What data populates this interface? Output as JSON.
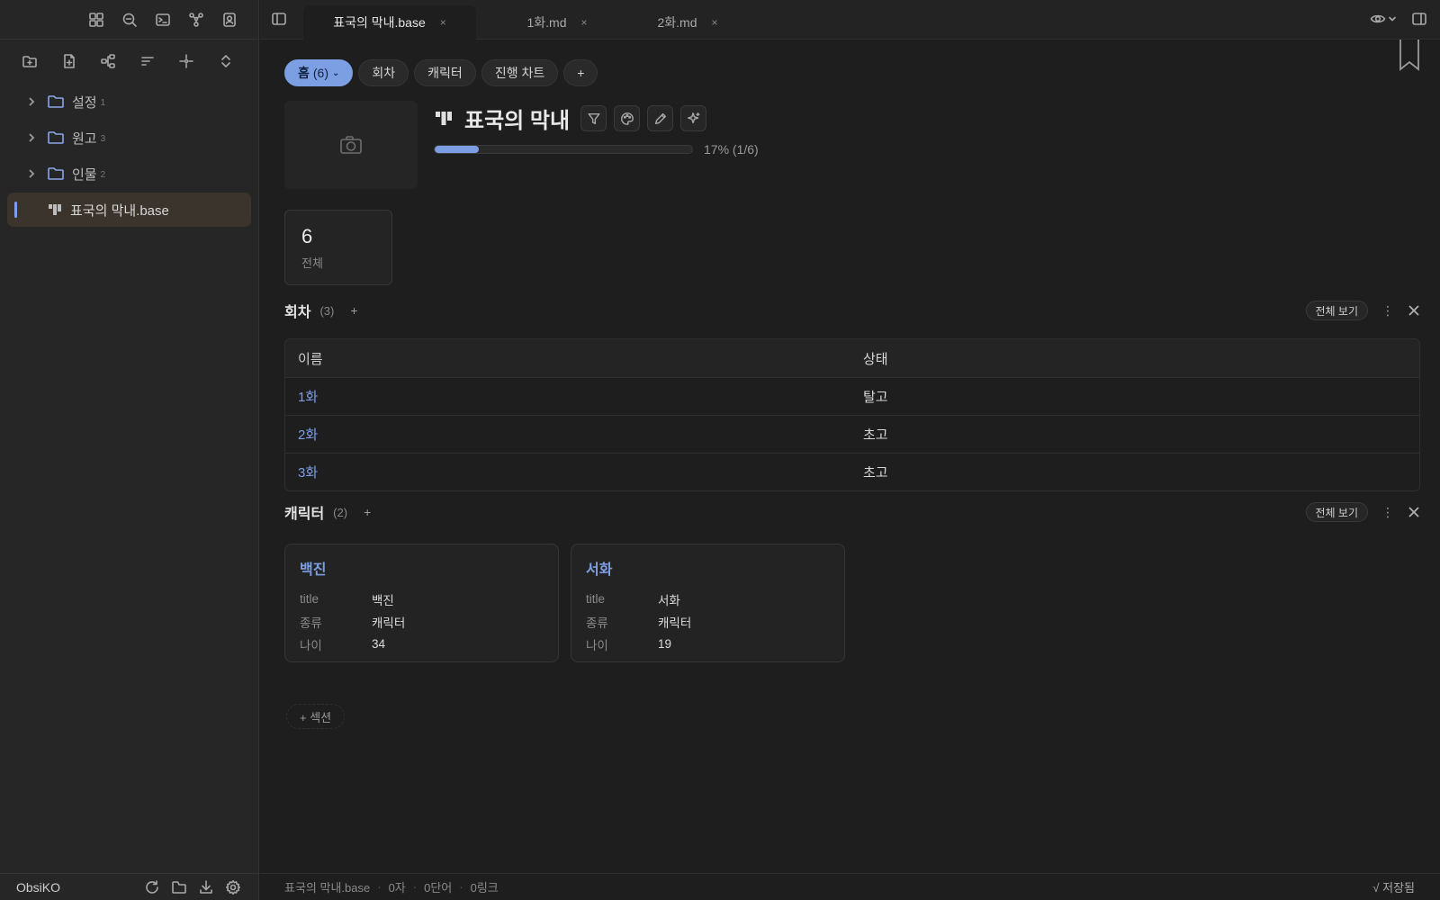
{
  "sidebar": {
    "tree": [
      {
        "label": "설정",
        "count": "1"
      },
      {
        "label": "원고",
        "count": "3"
      },
      {
        "label": "인물",
        "count": "2"
      }
    ],
    "active_file": "표국의 막내.base",
    "vault_name": "ObsiKO"
  },
  "tabs": [
    {
      "label": "표국의 막내.base",
      "close": "×"
    },
    {
      "label": "1화.md",
      "close": "×"
    },
    {
      "label": "2화.md",
      "close": "×"
    }
  ],
  "pills": {
    "home": "홈",
    "home_count": "(6)",
    "home_caret": "⌄",
    "episodes": "회차",
    "characters": "캐릭터",
    "progress_chart": "진행 차트",
    "add": "+"
  },
  "header": {
    "title": "표국의 막내",
    "progress": 0.17,
    "progress_label": "17% (1/6)"
  },
  "stat": {
    "value": "6",
    "label": "전체"
  },
  "episodes": {
    "title": "회차",
    "count": "(3)",
    "add": "+",
    "view_all": "전체 보기",
    "more": "⋮",
    "columns": [
      "이름",
      "상태"
    ],
    "rows": [
      {
        "name": "1화",
        "status": "탈고"
      },
      {
        "name": "2화",
        "status": "초고"
      },
      {
        "name": "3화",
        "status": "초고"
      }
    ]
  },
  "characters": {
    "title": "캐릭터",
    "count": "(2)",
    "add": "+",
    "view_all": "전체 보기",
    "more": "⋮",
    "cards": [
      {
        "name": "백진",
        "fields": [
          {
            "k": "title",
            "v": "백진"
          },
          {
            "k": "종류",
            "v": "캐릭터"
          },
          {
            "k": "나이",
            "v": "34"
          }
        ]
      },
      {
        "name": "서화",
        "fields": [
          {
            "k": "title",
            "v": "서화"
          },
          {
            "k": "종류",
            "v": "캐릭터"
          },
          {
            "k": "나이",
            "v": "19"
          }
        ]
      }
    ]
  },
  "add_section": "+ 섹션",
  "status": {
    "file": "표국의 막내.base",
    "chars": "0자",
    "words": "0단어",
    "links": "0링크",
    "sep": "·",
    "saved": "√ 저장됨"
  },
  "colors": {
    "accent": "#7c9fe3",
    "folder": "#8ba7e6",
    "bg": "#1e1e1e",
    "sidebar_bg": "#262626"
  }
}
